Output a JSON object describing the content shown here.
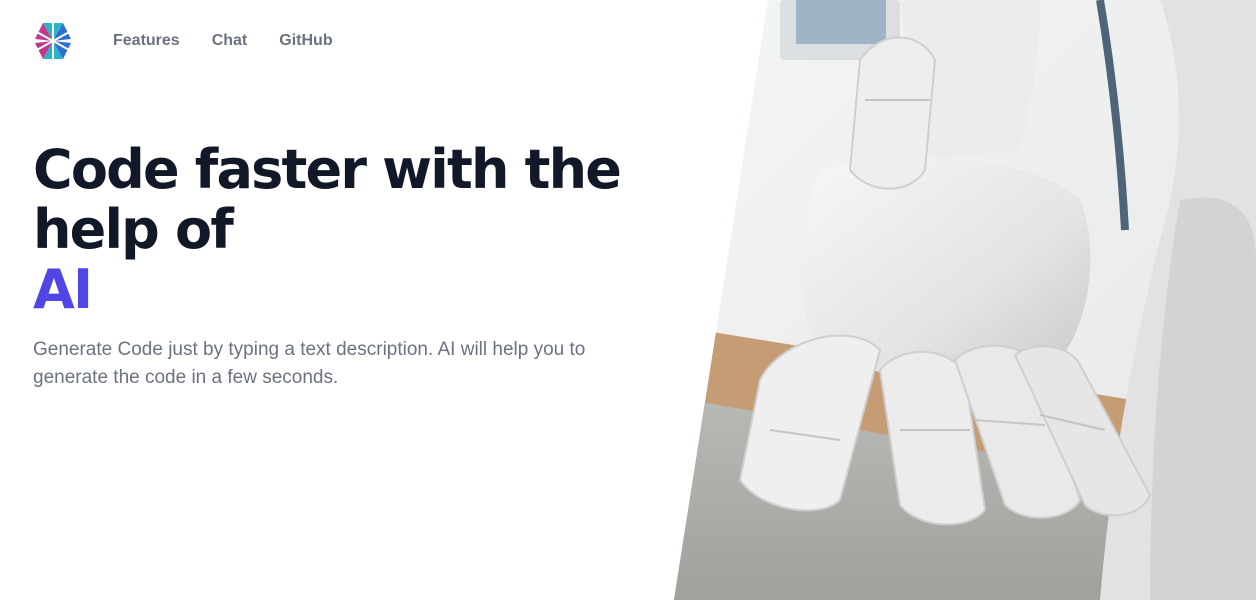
{
  "nav": {
    "logo_icon": "asterisk-triangles-logo",
    "links": [
      "Features",
      "Chat",
      "GitHub"
    ]
  },
  "hero": {
    "title_line1": "Code faster with the",
    "title_line2": "help of",
    "title_accent": "AI",
    "description": "Generate Code just by typing a text description. AI will help you to generate the code in a few seconds."
  },
  "image": {
    "subject_icon": "robot-hand-photo"
  },
  "colors": {
    "accent": "#4f46e5",
    "heading": "#111827",
    "body_text": "#6b7280",
    "logo_blue": "#2f6fd0",
    "logo_magenta": "#c03a8b",
    "logo_teal": "#2bb3c9"
  }
}
